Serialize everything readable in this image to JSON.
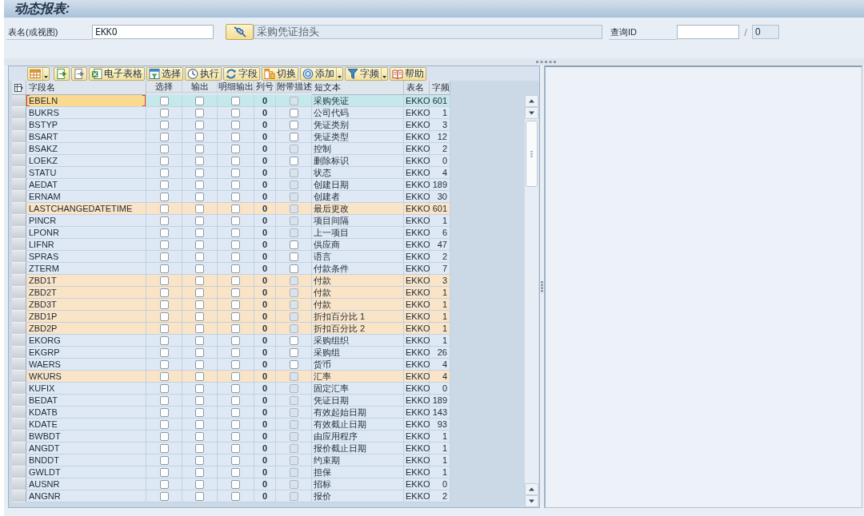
{
  "window": {
    "title": "动态报表:"
  },
  "selection": {
    "table_label": "表名(或视图)",
    "table_value": "EKKO",
    "description": "采购凭证抬头",
    "query_label": "查询ID",
    "separator": "/",
    "query_count": "0"
  },
  "toolbar": [
    {
      "kind": "icon",
      "menu": true
    },
    {
      "kind": "icon",
      "menu": false
    },
    {
      "kind": "icon",
      "menu": false
    },
    {
      "kind": "labeled",
      "label": "电子表格",
      "menu": false
    },
    {
      "kind": "labeled",
      "label": "选择",
      "menu": false
    },
    {
      "kind": "labeled",
      "label": "执行",
      "menu": false
    },
    {
      "kind": "labeled",
      "label": "字段",
      "menu": false
    },
    {
      "kind": "labeled",
      "label": "切换",
      "menu": false
    },
    {
      "kind": "labeled",
      "label": "添加",
      "menu": true
    },
    {
      "kind": "labeled",
      "label": "字频",
      "menu": true
    },
    {
      "kind": "labeled",
      "label": "帮助",
      "menu": false
    }
  ],
  "table": {
    "columns": [
      "字段名",
      "选择",
      "输出",
      "明细输出",
      "列号",
      "附带描述",
      "短文本",
      "表名",
      "字频"
    ],
    "rows": [
      {
        "field": "EBELN",
        "select": false,
        "output": false,
        "detail": false,
        "col": "0",
        "desc": false,
        "desc_disabled": true,
        "text": "采购凭证",
        "table": "EKKO",
        "count": "601",
        "selected": true,
        "highlighted": false
      },
      {
        "field": "BUKRS",
        "select": false,
        "output": false,
        "detail": false,
        "col": "0",
        "desc": false,
        "desc_disabled": false,
        "text": "公司代码",
        "table": "EKKO",
        "count": "1",
        "selected": false,
        "highlighted": false
      },
      {
        "field": "BSTYP",
        "select": false,
        "output": false,
        "detail": false,
        "col": "0",
        "desc": false,
        "desc_disabled": false,
        "text": "凭证类别",
        "table": "EKKO",
        "count": "3",
        "selected": false,
        "highlighted": false
      },
      {
        "field": "BSART",
        "select": false,
        "output": false,
        "detail": false,
        "col": "0",
        "desc": false,
        "desc_disabled": false,
        "text": "凭证类型",
        "table": "EKKO",
        "count": "12",
        "selected": false,
        "highlighted": false
      },
      {
        "field": "BSAKZ",
        "select": false,
        "output": false,
        "detail": false,
        "col": "0",
        "desc": false,
        "desc_disabled": true,
        "text": "控制",
        "table": "EKKO",
        "count": "2",
        "selected": false,
        "highlighted": false
      },
      {
        "field": "LOEKZ",
        "select": false,
        "output": false,
        "detail": false,
        "col": "0",
        "desc": false,
        "desc_disabled": false,
        "text": "删除标识",
        "table": "EKKO",
        "count": "0",
        "selected": false,
        "highlighted": false
      },
      {
        "field": "STATU",
        "select": false,
        "output": false,
        "detail": false,
        "col": "0",
        "desc": false,
        "desc_disabled": true,
        "text": "状态",
        "table": "EKKO",
        "count": "4",
        "selected": false,
        "highlighted": false
      },
      {
        "field": "AEDAT",
        "select": false,
        "output": false,
        "detail": false,
        "col": "0",
        "desc": false,
        "desc_disabled": true,
        "text": "创建日期",
        "table": "EKKO",
        "count": "189",
        "selected": false,
        "highlighted": false
      },
      {
        "field": "ERNAM",
        "select": false,
        "output": false,
        "detail": false,
        "col": "0",
        "desc": false,
        "desc_disabled": true,
        "text": "创建者",
        "table": "EKKO",
        "count": "30",
        "selected": false,
        "highlighted": false
      },
      {
        "field": "LASTCHANGEDATETIME",
        "select": false,
        "output": false,
        "detail": false,
        "col": "0",
        "desc": false,
        "desc_disabled": true,
        "text": "最后更改",
        "table": "EKKO",
        "count": "601",
        "selected": false,
        "highlighted": true
      },
      {
        "field": "PINCR",
        "select": false,
        "output": false,
        "detail": false,
        "col": "0",
        "desc": false,
        "desc_disabled": true,
        "text": "项目间隔",
        "table": "EKKO",
        "count": "1",
        "selected": false,
        "highlighted": false
      },
      {
        "field": "LPONR",
        "select": false,
        "output": false,
        "detail": false,
        "col": "0",
        "desc": false,
        "desc_disabled": true,
        "text": "上一项目",
        "table": "EKKO",
        "count": "6",
        "selected": false,
        "highlighted": false
      },
      {
        "field": "LIFNR",
        "select": false,
        "output": false,
        "detail": false,
        "col": "0",
        "desc": false,
        "desc_disabled": false,
        "text": "供应商",
        "table": "EKKO",
        "count": "47",
        "selected": false,
        "highlighted": false
      },
      {
        "field": "SPRAS",
        "select": false,
        "output": false,
        "detail": false,
        "col": "0",
        "desc": false,
        "desc_disabled": false,
        "text": "语言",
        "table": "EKKO",
        "count": "2",
        "selected": false,
        "highlighted": false
      },
      {
        "field": "ZTERM",
        "select": false,
        "output": false,
        "detail": false,
        "col": "0",
        "desc": false,
        "desc_disabled": false,
        "text": "付款条件",
        "table": "EKKO",
        "count": "7",
        "selected": false,
        "highlighted": false
      },
      {
        "field": "ZBD1T",
        "select": false,
        "output": false,
        "detail": false,
        "col": "0",
        "desc": false,
        "desc_disabled": true,
        "text": "付款",
        "table": "EKKO",
        "count": "3",
        "selected": false,
        "highlighted": true
      },
      {
        "field": "ZBD2T",
        "select": false,
        "output": false,
        "detail": false,
        "col": "0",
        "desc": false,
        "desc_disabled": true,
        "text": "付款",
        "table": "EKKO",
        "count": "1",
        "selected": false,
        "highlighted": true
      },
      {
        "field": "ZBD3T",
        "select": false,
        "output": false,
        "detail": false,
        "col": "0",
        "desc": false,
        "desc_disabled": true,
        "text": "付款",
        "table": "EKKO",
        "count": "1",
        "selected": false,
        "highlighted": true
      },
      {
        "field": "ZBD1P",
        "select": false,
        "output": false,
        "detail": false,
        "col": "0",
        "desc": false,
        "desc_disabled": true,
        "text": "折扣百分比 1",
        "table": "EKKO",
        "count": "1",
        "selected": false,
        "highlighted": true
      },
      {
        "field": "ZBD2P",
        "select": false,
        "output": false,
        "detail": false,
        "col": "0",
        "desc": false,
        "desc_disabled": true,
        "text": "折扣百分比 2",
        "table": "EKKO",
        "count": "1",
        "selected": false,
        "highlighted": true
      },
      {
        "field": "EKORG",
        "select": false,
        "output": false,
        "detail": false,
        "col": "0",
        "desc": false,
        "desc_disabled": false,
        "text": "采购组织",
        "table": "EKKO",
        "count": "1",
        "selected": false,
        "highlighted": false
      },
      {
        "field": "EKGRP",
        "select": false,
        "output": false,
        "detail": false,
        "col": "0",
        "desc": false,
        "desc_disabled": false,
        "text": "采购组",
        "table": "EKKO",
        "count": "26",
        "selected": false,
        "highlighted": false
      },
      {
        "field": "WAERS",
        "select": false,
        "output": false,
        "detail": false,
        "col": "0",
        "desc": false,
        "desc_disabled": false,
        "text": "货币",
        "table": "EKKO",
        "count": "4",
        "selected": false,
        "highlighted": false
      },
      {
        "field": "WKURS",
        "select": false,
        "output": false,
        "detail": false,
        "col": "0",
        "desc": false,
        "desc_disabled": true,
        "text": "汇率",
        "table": "EKKO",
        "count": "4",
        "selected": false,
        "highlighted": true
      },
      {
        "field": "KUFIX",
        "select": false,
        "output": false,
        "detail": false,
        "col": "0",
        "desc": false,
        "desc_disabled": true,
        "text": "固定汇率",
        "table": "EKKO",
        "count": "0",
        "selected": false,
        "highlighted": false
      },
      {
        "field": "BEDAT",
        "select": false,
        "output": false,
        "detail": false,
        "col": "0",
        "desc": false,
        "desc_disabled": true,
        "text": "凭证日期",
        "table": "EKKO",
        "count": "189",
        "selected": false,
        "highlighted": false
      },
      {
        "field": "KDATB",
        "select": false,
        "output": false,
        "detail": false,
        "col": "0",
        "desc": false,
        "desc_disabled": true,
        "text": "有效起始日期",
        "table": "EKKO",
        "count": "143",
        "selected": false,
        "highlighted": false
      },
      {
        "field": "KDATE",
        "select": false,
        "output": false,
        "detail": false,
        "col": "0",
        "desc": false,
        "desc_disabled": true,
        "text": "有效截止日期",
        "table": "EKKO",
        "count": "93",
        "selected": false,
        "highlighted": false
      },
      {
        "field": "BWBDT",
        "select": false,
        "output": false,
        "detail": false,
        "col": "0",
        "desc": false,
        "desc_disabled": true,
        "text": "由应用程序",
        "table": "EKKO",
        "count": "1",
        "selected": false,
        "highlighted": false
      },
      {
        "field": "ANGDT",
        "select": false,
        "output": false,
        "detail": false,
        "col": "0",
        "desc": false,
        "desc_disabled": true,
        "text": "报价截止日期",
        "table": "EKKO",
        "count": "1",
        "selected": false,
        "highlighted": false
      },
      {
        "field": "BNDDT",
        "select": false,
        "output": false,
        "detail": false,
        "col": "0",
        "desc": false,
        "desc_disabled": true,
        "text": "约束期",
        "table": "EKKO",
        "count": "1",
        "selected": false,
        "highlighted": false
      },
      {
        "field": "GWLDT",
        "select": false,
        "output": false,
        "detail": false,
        "col": "0",
        "desc": false,
        "desc_disabled": true,
        "text": "担保",
        "table": "EKKO",
        "count": "1",
        "selected": false,
        "highlighted": false
      },
      {
        "field": "AUSNR",
        "select": false,
        "output": false,
        "detail": false,
        "col": "0",
        "desc": false,
        "desc_disabled": true,
        "text": "招标",
        "table": "EKKO",
        "count": "0",
        "selected": false,
        "highlighted": false
      },
      {
        "field": "ANGNR",
        "select": false,
        "output": false,
        "detail": false,
        "col": "0",
        "desc": false,
        "desc_disabled": true,
        "text": "报价",
        "table": "EKKO",
        "count": "2",
        "selected": false,
        "highlighted": false
      }
    ]
  }
}
